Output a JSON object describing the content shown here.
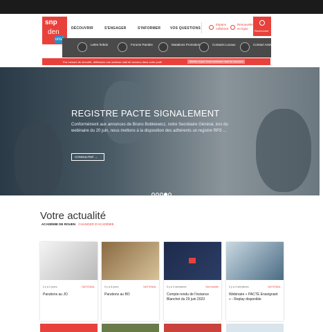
{
  "header": {
    "logo_top": "snp",
    "logo_bottom": "den",
    "logo_badge": "unsa",
    "nav": [
      "DÉCOUVRIR",
      "S'ENGAGER",
      "S'INFORMER",
      "VOS QUESTIONS"
    ],
    "espace": [
      "Espace",
      "Adhérent"
    ],
    "renouveler": [
      "Renouveler",
      "en ligne"
    ],
    "search_label": "Rechercher"
  },
  "subnav": [
    {
      "icon": "school-icon",
      "label": "Lettre hebdo"
    },
    {
      "icon": "chat-icon",
      "label": "Forums Paroles"
    },
    {
      "icon": "exchange-icon",
      "label": "Mutations Promotions"
    },
    {
      "icon": "location-icon",
      "label": "Contacts Locaux"
    },
    {
      "icon": "support-icon",
      "label": "Contact Assistance"
    }
  ],
  "alert": {
    "text": "Par mesure de sécurité, définissez une adresse mail de secours dans votre profil",
    "button": "Mettre à jour l'mon adresse mail de secours"
  },
  "hero": {
    "title": "REGISTRE PACTE SIGNALEMENT",
    "text": "Conformément aux annonces de Bruno Bobkiewicz, notre Secrétaire Général, lors du webinaire du 20 juin, nous mettons à la disposition des adhérents un registre RPS ...",
    "button": "CONSULTER  →",
    "slides": 5,
    "active_slide": 3
  },
  "news": {
    "title": "Votre actualité",
    "academy": "ACADÉMIE DE ROUEN",
    "change_link": "CHANGER D'ACADÉMIE",
    "cards": [
      {
        "meta": "Il y a 2 jours",
        "tag": "NATIONAL",
        "title": "Parutions au JO",
        "color1": "#f2f2f2",
        "color2": "#a8a8a8"
      },
      {
        "meta": "Il y a 6 jours",
        "tag": "NATIONAL",
        "title": "Parutions au BO",
        "color1": "#8a6a42",
        "color2": "#d7c29a"
      },
      {
        "meta": "Il y a 3 semaines",
        "tag": "Normandie",
        "title": "Compte-rendu de l'instance Blanchet du 29 juin 2023",
        "color1": "#1d2b4a",
        "color2": "#2c3d66"
      },
      {
        "meta": "Il y a 4 semaines",
        "tag": "NATIONAL",
        "title": "Webinaire « PACTE Enseignant » - Replay disponible",
        "color1": "#c9d9e2",
        "color2": "#4b6c84"
      }
    ]
  }
}
